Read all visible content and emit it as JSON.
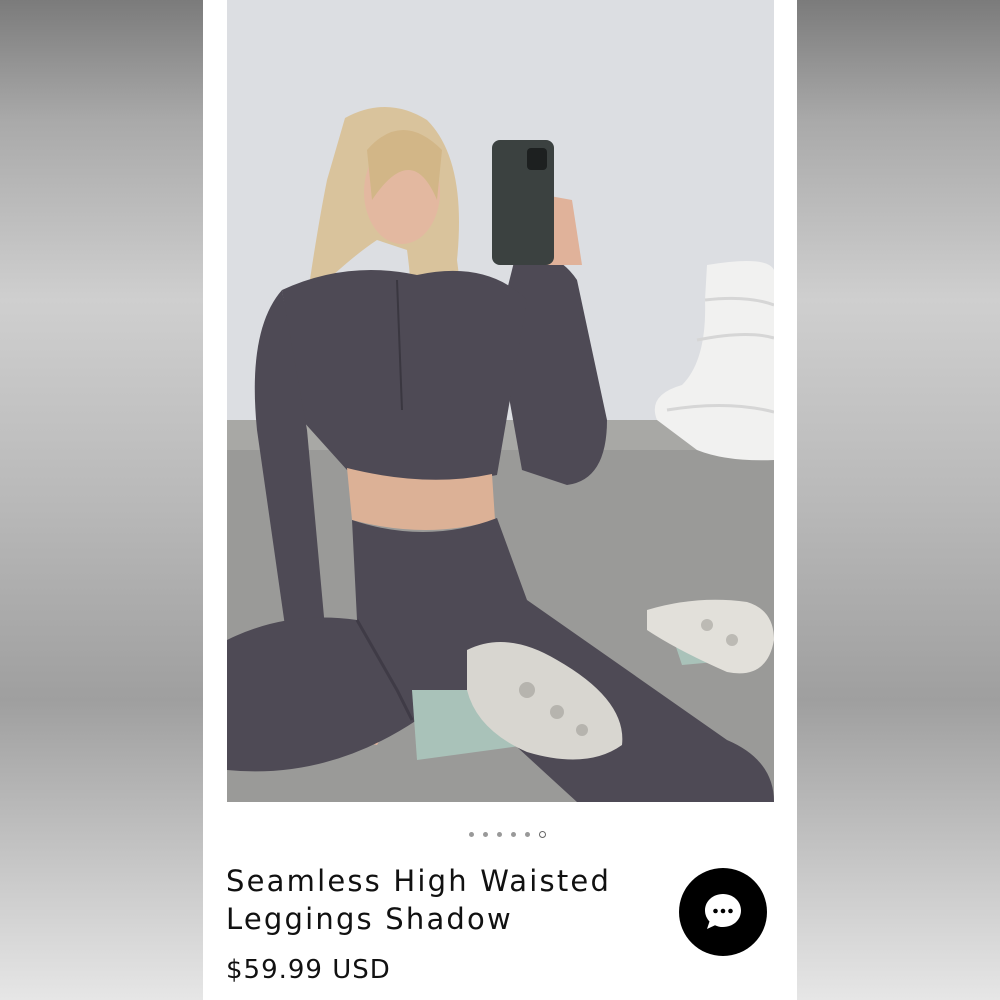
{
  "product": {
    "title_line1": "Seamless High Waisted",
    "title_line2": "Leggings Shadow",
    "price": "$59.99 USD",
    "image_description": "product-photo"
  },
  "carousel": {
    "total": 6,
    "active_index": 5
  },
  "chat": {
    "icon": "chat-bubble-icon"
  },
  "colors": {
    "background": "#ffffff",
    "text": "#111111",
    "chat_button": "#000000",
    "garment": "#4e4a55"
  }
}
